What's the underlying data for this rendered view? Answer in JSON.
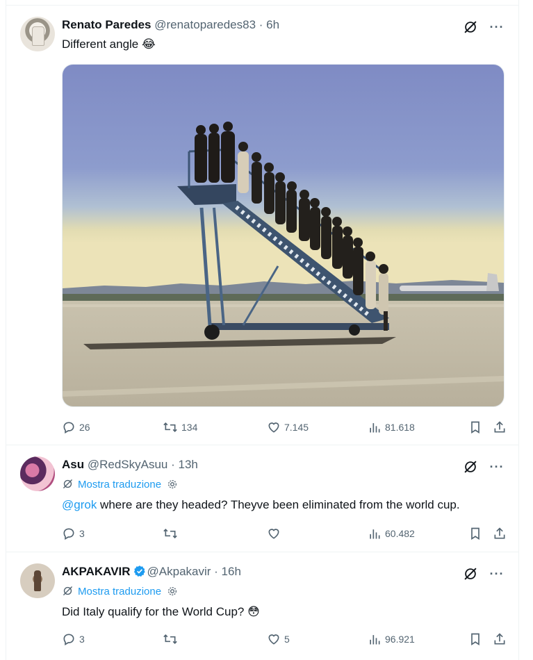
{
  "posts": [
    {
      "author_name": "Renato Paredes",
      "author_handle": "@renatoparedes83",
      "time": " · 6h",
      "text": "Different angle",
      "emoji": "😂",
      "media": "photo-airstairs-crowd",
      "stats": {
        "replies": "26",
        "reposts": "134",
        "likes": "7.145",
        "views": "81.618"
      }
    },
    {
      "author_name": "Asu",
      "author_handle": "@RedSkyAsuu",
      "time": " · 13h",
      "translate_label": "Mostra traduzione",
      "mention": "@grok",
      "text": " where are they headed? Theyve been eliminated from the world cup.",
      "stats": {
        "replies": "3",
        "reposts": "",
        "likes": "",
        "views": "60.482"
      }
    },
    {
      "author_name": "AKPAKAVIR",
      "verified": true,
      "author_handle": "@Akpakavir",
      "time": " · 16h",
      "translate_label": "Mostra traduzione",
      "text": "Did Italy qualify for the World Cup?",
      "emoji": "😳",
      "stats": {
        "replies": "3",
        "reposts": "",
        "likes": "5",
        "views": "96.921"
      }
    }
  ],
  "icons": {
    "grok": "grok-icon",
    "more": "more-icon",
    "reply": "reply-icon",
    "repost": "repost-icon",
    "like": "heart-icon",
    "views": "views-icon",
    "bookmark": "bookmark-icon",
    "share": "share-icon"
  },
  "colors": {
    "accent": "#1d9bf0",
    "text": "#0f1419",
    "secondary": "#536471",
    "border": "#eff3f4"
  }
}
